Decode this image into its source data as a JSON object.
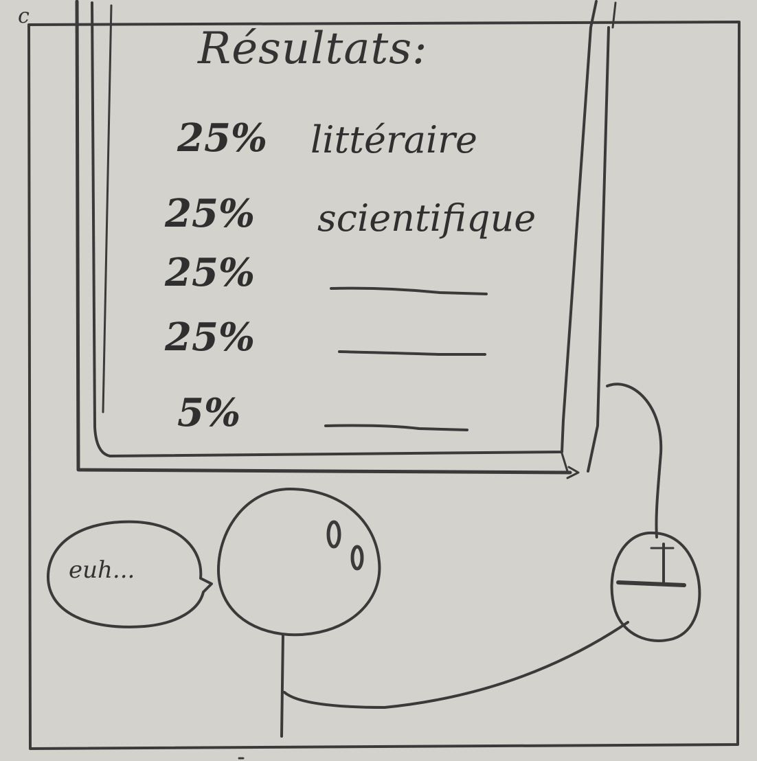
{
  "corner_mark": "c",
  "results_panel": {
    "title": "Résultats:",
    "rows": [
      {
        "percent": "25%",
        "label": "littéraire"
      },
      {
        "percent": "25%",
        "label": "scientifique"
      },
      {
        "percent": "25%",
        "label": ""
      },
      {
        "percent": "25%",
        "label": ""
      },
      {
        "percent": "5%",
        "label": ""
      }
    ]
  },
  "speech_bubble": {
    "text": "euh..."
  },
  "colors": {
    "paper": "#d4d2cc",
    "ink": "#3a3a3a"
  }
}
